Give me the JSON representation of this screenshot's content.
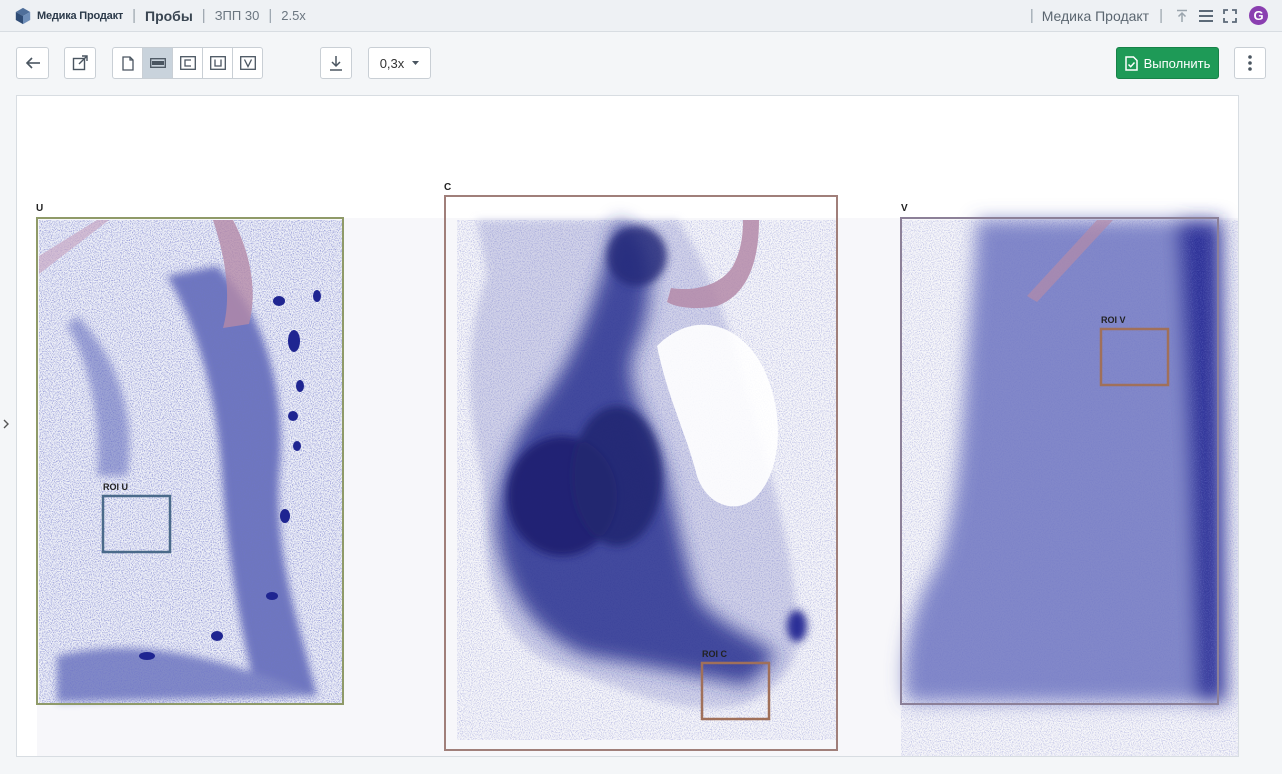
{
  "header": {
    "logo_text": "Медика Продакт",
    "section": "Пробы",
    "crumbs": [
      "ЗПП 30",
      "2.5x"
    ],
    "org_name": "Медика Продакт",
    "avatar_letter": "G"
  },
  "toolbar": {
    "zoom": "0,3x",
    "run_label": "Выполнить"
  },
  "samples": [
    {
      "label": "U",
      "roi_label": "ROI U"
    },
    {
      "label": "C",
      "roi_label": "ROI C"
    },
    {
      "label": "V",
      "roi_label": "ROI V"
    }
  ],
  "colors": {
    "accent_green": "#1e9a57",
    "stain_blue": "#2a2f96",
    "frame_u": "#8f9a68",
    "frame_c": "#a07f7a",
    "frame_v": "#8c8098",
    "roi_u": "#4a6a8a",
    "roi_c": "#a0705a",
    "roi_v": "#a0705a"
  }
}
